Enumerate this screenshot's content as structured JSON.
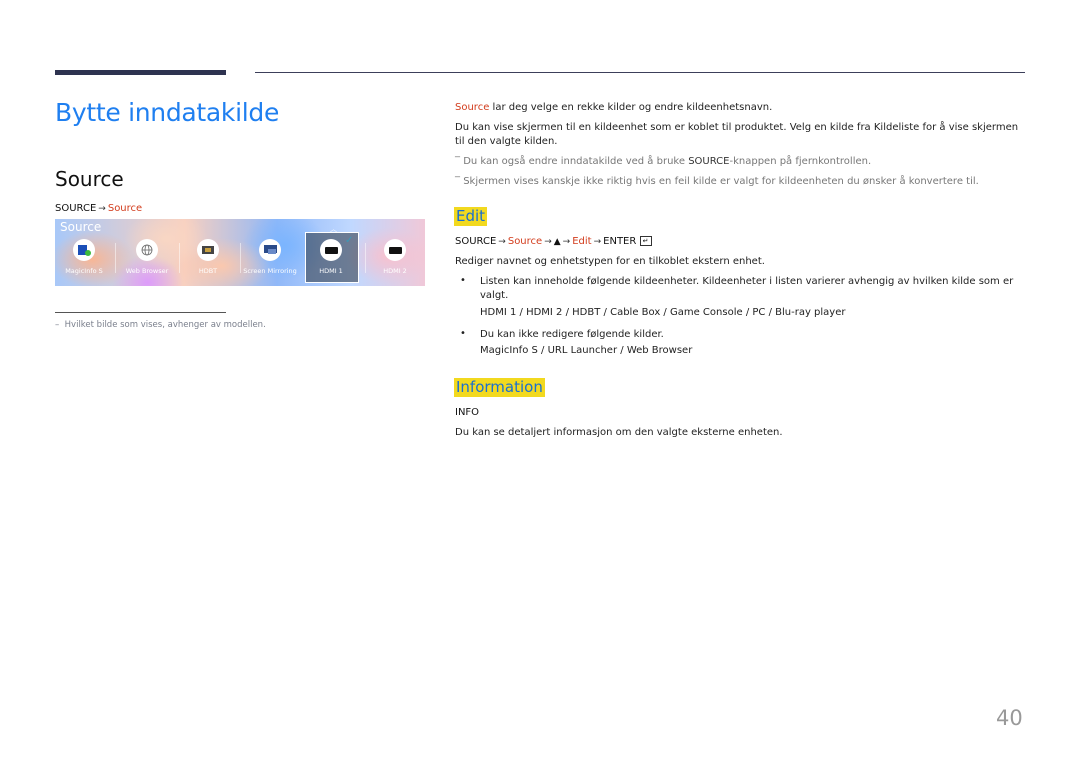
{
  "page": {
    "title": "Bytte inndatakilde",
    "page_number": "40"
  },
  "left": {
    "section_title": "Source",
    "path": {
      "key": "SOURCE",
      "target": "Source"
    },
    "banner": {
      "title": "Source",
      "items": [
        {
          "label": "MagicInfo S",
          "icon": "magicinfo-icon"
        },
        {
          "label": "Web Browser",
          "icon": "globe-icon"
        },
        {
          "label": "HDBT",
          "icon": "hdbt-port-icon"
        },
        {
          "label": "Screen Mirroring",
          "icon": "screen-mirroring-icon"
        },
        {
          "label": "HDMI 1",
          "icon": "hdmi-icon",
          "selected": true
        },
        {
          "label": "HDMI 2",
          "icon": "hdmi-icon"
        }
      ]
    },
    "footnote": "Hvilket bilde som vises, avhenger av modellen."
  },
  "right": {
    "intro_link": "Source",
    "intro_rest": " lar deg velge en rekke kilder og endre kildeenhetsnavn.",
    "para2": "Du kan vise skjermen til en kildeenhet som er koblet til produktet. Velg en kilde fra Kildeliste for å vise skjermen til den valgte kilden.",
    "note1_pre": "Du kan også endre inndatakilde ved å bruke ",
    "note1_key": "SOURCE",
    "note1_post": "-knappen på fjernkontrollen.",
    "note2": "Skjermen vises kanskje ikke riktig hvis en feil kilde er valgt for kildeenheten du ønsker å konvertere til.",
    "edit": {
      "heading": "Edit",
      "path": [
        "SOURCE",
        "Source",
        "▲",
        "Edit",
        "ENTER"
      ],
      "description": "Rediger navnet og enhetstypen for en tilkoblet ekstern enhet.",
      "bullet1": "Listen kan inneholde følgende kildeenheter. Kildeenheter i listen varierer avhengig av hvilken kilde som er valgt.",
      "bullet1_items": [
        "HDMI 1",
        "HDMI 2",
        "HDBT",
        "Cable Box",
        "Game Console",
        "PC",
        "Blu-ray player"
      ],
      "bullet2": "Du kan ikke redigere følgende kilder.",
      "bullet2_items": [
        "MagicInfo S",
        "URL Launcher",
        "Web Browser"
      ]
    },
    "information": {
      "heading": "Information",
      "key": "INFO",
      "description": "Du kan se detaljert informasjon om den valgte eksterne enheten."
    }
  },
  "colors": {
    "title_blue": "#1f7ff0",
    "link_red": "#d23c1c",
    "highlight_yellow": "#f2d91f"
  }
}
